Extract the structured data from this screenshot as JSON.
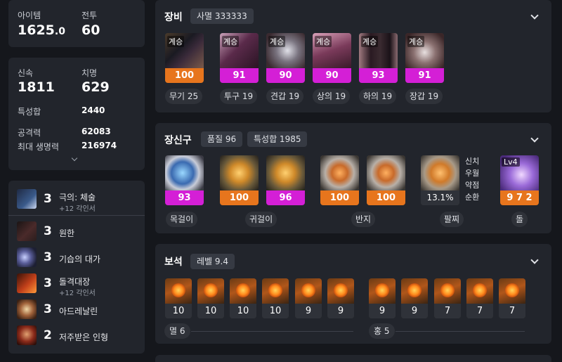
{
  "summary": {
    "item_label": "아이템",
    "item_level": "1625",
    "item_level_decimal": ".0",
    "combat_label": "전투",
    "combat_level": "60"
  },
  "stats": {
    "swift_label": "신속",
    "swift_value": "1811",
    "crit_label": "치명",
    "crit_value": "629",
    "trait_total_label": "특성합",
    "trait_total_value": "2440",
    "attack_label": "공격력",
    "attack_value": "62083",
    "hp_label": "최대 생명력",
    "hp_value": "216974"
  },
  "engravings": [
    {
      "level": "3",
      "name": "극의: 체술",
      "sub": "+12 각인서",
      "icon": "body-art-icon"
    },
    {
      "level": "3",
      "name": "원한",
      "sub": "",
      "icon": "grudge-icon"
    },
    {
      "level": "3",
      "name": "기습의 대가",
      "sub": "",
      "icon": "ambush-icon"
    },
    {
      "level": "3",
      "name": "돌격대장",
      "sub": "+12 각인서",
      "icon": "charge-icon"
    },
    {
      "level": "3",
      "name": "아드레날린",
      "sub": "",
      "icon": "adrenaline-icon"
    },
    {
      "level": "2",
      "name": "저주받은 인형",
      "sub": "",
      "icon": "cursed-doll-icon"
    }
  ],
  "equipment": {
    "title": "장비",
    "set_pill": "사멸 333333",
    "items": [
      {
        "tag": "계승",
        "quality": "100",
        "quality_color": "#e7751d",
        "label": "무기 25",
        "icon": "weapon-icon"
      },
      {
        "tag": "계승",
        "quality": "91",
        "quality_color": "#d41fd6",
        "label": "투구 19",
        "icon": "helmet-icon"
      },
      {
        "tag": "계승",
        "quality": "90",
        "quality_color": "#d41fd6",
        "label": "견갑 19",
        "icon": "shoulder-icon"
      },
      {
        "tag": "계승",
        "quality": "90",
        "quality_color": "#d41fd6",
        "label": "상의 19",
        "icon": "chest-icon"
      },
      {
        "tag": "계승",
        "quality": "93",
        "quality_color": "#d41fd6",
        "label": "하의 19",
        "icon": "pants-icon"
      },
      {
        "tag": "계승",
        "quality": "91",
        "quality_color": "#d41fd6",
        "label": "장갑 19",
        "icon": "gloves-icon"
      }
    ]
  },
  "accessories": {
    "title": "장신구",
    "quality_pill": "품질 96",
    "trait_pill": "특성합 1985",
    "items": [
      {
        "quality": "93",
        "quality_color": "#d41fd6",
        "icon": "necklace-icon"
      },
      {
        "quality": "100",
        "quality_color": "#e7751d",
        "icon": "earring-icon"
      },
      {
        "quality": "96",
        "quality_color": "#d41fd6",
        "icon": "earring-icon"
      },
      {
        "quality": "100",
        "quality_color": "#e7751d",
        "icon": "ring-icon"
      },
      {
        "quality": "100",
        "quality_color": "#e7751d",
        "icon": "ring-icon"
      }
    ],
    "bracelet": {
      "value": "13.1%",
      "effects": [
        "신치",
        "우월",
        "약점",
        "순환"
      ],
      "icon": "bracelet-icon"
    },
    "stone": {
      "level_badge": "Lv4",
      "value": "9 7 2",
      "icon": "ability-stone-icon"
    },
    "labels": {
      "necklace": "목걸이",
      "earring": "귀걸이",
      "ring": "반지",
      "bracelet": "팔찌",
      "stone": "돌"
    }
  },
  "gems": {
    "title": "보석",
    "level_pill": "레벨 9.4",
    "annihilation": {
      "label": "멸 6",
      "values": [
        "10",
        "10",
        "10",
        "10",
        "9",
        "9"
      ]
    },
    "crimson": {
      "label": "홍 5",
      "values": [
        "9",
        "9",
        "7",
        "7",
        "7"
      ]
    }
  }
}
